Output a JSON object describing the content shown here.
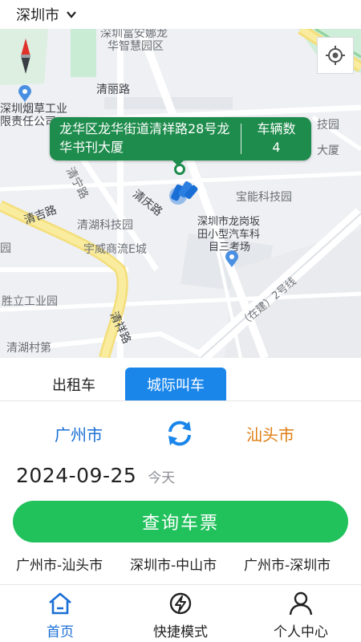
{
  "header": {
    "city": "深圳市",
    "dropdown_icon": "chevron-down-icon"
  },
  "map": {
    "labels": {
      "hua_zhihui": "华智慧园区",
      "shen_an": "深圳富安娜龙",
      "qingli_road": "清丽路",
      "tobacco_1": "深圳烟草工业",
      "tobacco_2": "限责任公司",
      "keji_yuan": "技园",
      "da_sha": "大厦",
      "qingning_road": "清宁路",
      "qingqing_road": "清庆路",
      "baoneng": "宝能科技园",
      "qingji_road": "清吉路",
      "qinghu_keji": "清湖科技园",
      "longgang_1": "深圳市龙岗坂",
      "longgang_2": "田小型汽车科",
      "longgang_3": "目三考场",
      "yuwei": "宇威商流E城",
      "shengli": "胜立工业园",
      "qingxiang_road": "清祥路",
      "qinghu_village": "清湖村第",
      "expressway": "（在建）2号线",
      "yuan": "园"
    },
    "info_card": {
      "address": "龙华区龙华街道清祥路28号龙华书刊大厦",
      "vehicle_label": "车辆数",
      "vehicle_count": "4"
    },
    "locate_icon": "locate-icon",
    "compass_icon": "compass-icon"
  },
  "tabs": [
    {
      "label": "出租车",
      "active": false
    },
    {
      "label": "城际叫车",
      "active": true
    }
  ],
  "route": {
    "from": "广州市",
    "to": "汕头市",
    "swap_icon": "swap-icon"
  },
  "date": {
    "value": "2024-09-25",
    "relative": "今天"
  },
  "query_button": "查询车票",
  "history": [
    "广州市-汕头市",
    "深圳市-中山市",
    "广州市-深圳市"
  ],
  "bottom_nav": [
    {
      "label": "首页",
      "icon": "home-icon",
      "active": true
    },
    {
      "label": "快捷模式",
      "icon": "lightning-icon",
      "active": false
    },
    {
      "label": "个人中心",
      "icon": "user-icon",
      "active": false
    }
  ],
  "colors": {
    "accent_blue": "#1a86ea",
    "from_city": "#1a6fd6",
    "to_city": "#e07d12",
    "button_green": "#21c15c",
    "card_green": "#1e8c4c"
  }
}
